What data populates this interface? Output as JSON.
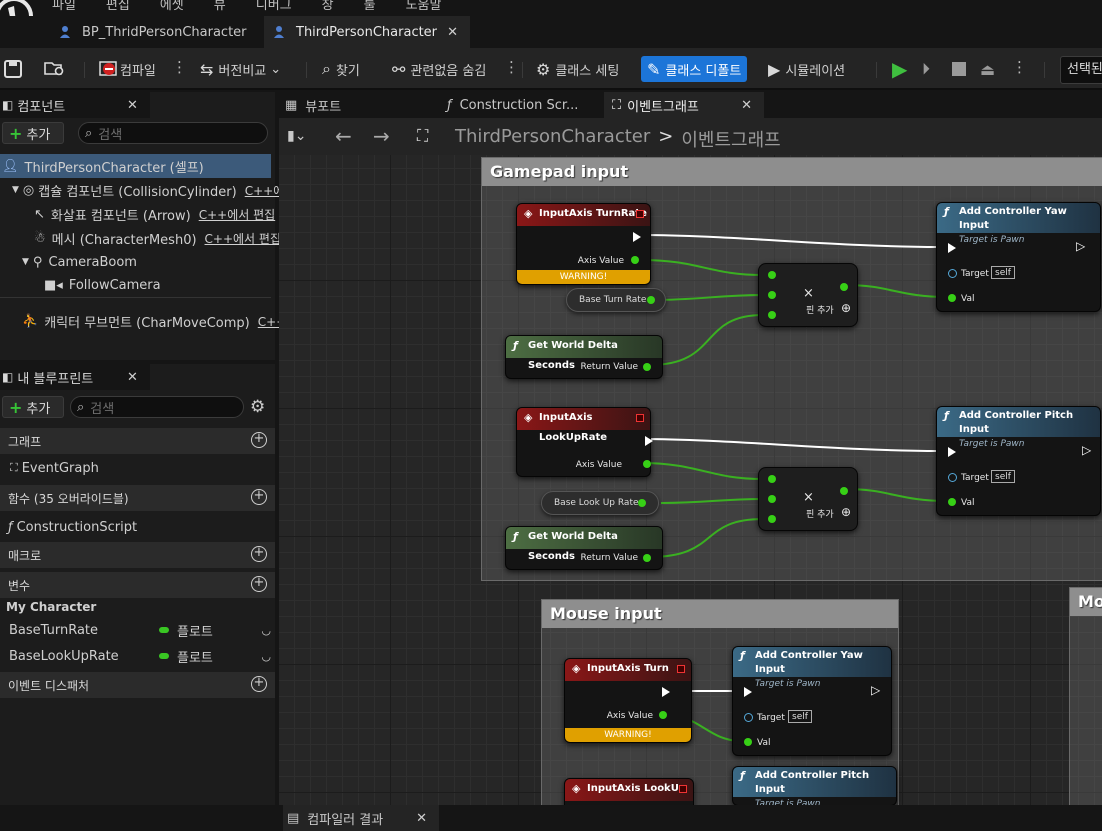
{
  "menu": [
    "파일",
    "편집",
    "에셋",
    "뷰",
    "디버그",
    "창",
    "툴",
    "도움말"
  ],
  "tabs": [
    {
      "label": "BP_ThridPersonCharacter"
    },
    {
      "label": "ThirdPersonCharacter"
    }
  ],
  "toolbar": {
    "compile": "컴파일",
    "diff": "버전비교",
    "find": "찾기",
    "hide": "관련없음 숨김",
    "class_settings": "클래스 세팅",
    "class_defaults": "클래스 디폴트",
    "simulation": "시뮬레이션",
    "select": "선택된"
  },
  "components": {
    "title": "컴포넌트",
    "add": "추가",
    "search": "검색",
    "items": [
      "ThirdPersonCharacter (셀프)",
      "캡슐 컴포넌트 (CollisionCylinder)",
      "C++에",
      "화살표 컴포넌트 (Arrow)",
      "C++에서 편집",
      "메시 (CharacterMesh0)",
      "C++에서 편집",
      "CameraBoom",
      "FollowCamera",
      "캐릭터 무브먼트 (CharMoveComp)",
      "C++에"
    ]
  },
  "myblueprint": {
    "title": "내 블루프린트",
    "add": "추가",
    "search": "검색",
    "graphs": "그래프",
    "eventgraph": "EventGraph",
    "functions": "함수 (35 오버라이드블)",
    "construction": "ConstructionScript",
    "macros": "매크로",
    "variables": "변수",
    "category": "My Character",
    "vars": [
      {
        "name": "BaseTurnRate",
        "type": "플로트"
      },
      {
        "name": "BaseLookUpRate",
        "type": "플로트"
      }
    ],
    "dispatchers": "이벤트 디스패처"
  },
  "graphtabs": {
    "viewport": "뷰포트",
    "construction": "Construction Scr...",
    "event": "이벤트그래프"
  },
  "breadcrumb": {
    "root": "ThirdPersonCharacter",
    "sep": ">",
    "leaf": "이벤트그래프"
  },
  "graph": {
    "comment1": "Gamepad input",
    "comment2": "Mouse input",
    "comment3": "Mo",
    "turnrate": "InputAxis TurnRate",
    "lookuprate": "InputAxis LookUpRate",
    "turn": "InputAxis Turn",
    "lookup": "InputAxis LookUp",
    "axis_value": "Axis Value",
    "warning": "WARNING!",
    "base_turn": "Base Turn Rate",
    "base_lookup": "Base Look Up Rate",
    "delta": "Get World Delta Seconds",
    "return_value": "Return Value",
    "add_pin": "핀 추가",
    "mult": "×",
    "yaw": "Add Controller Yaw Input",
    "pitch": "Add Controller Pitch Input",
    "target_is": "Target is Pawn",
    "target": "Target",
    "self": "self",
    "val": "Val"
  },
  "bottom": {
    "compiler": "컴파일러 결과"
  }
}
